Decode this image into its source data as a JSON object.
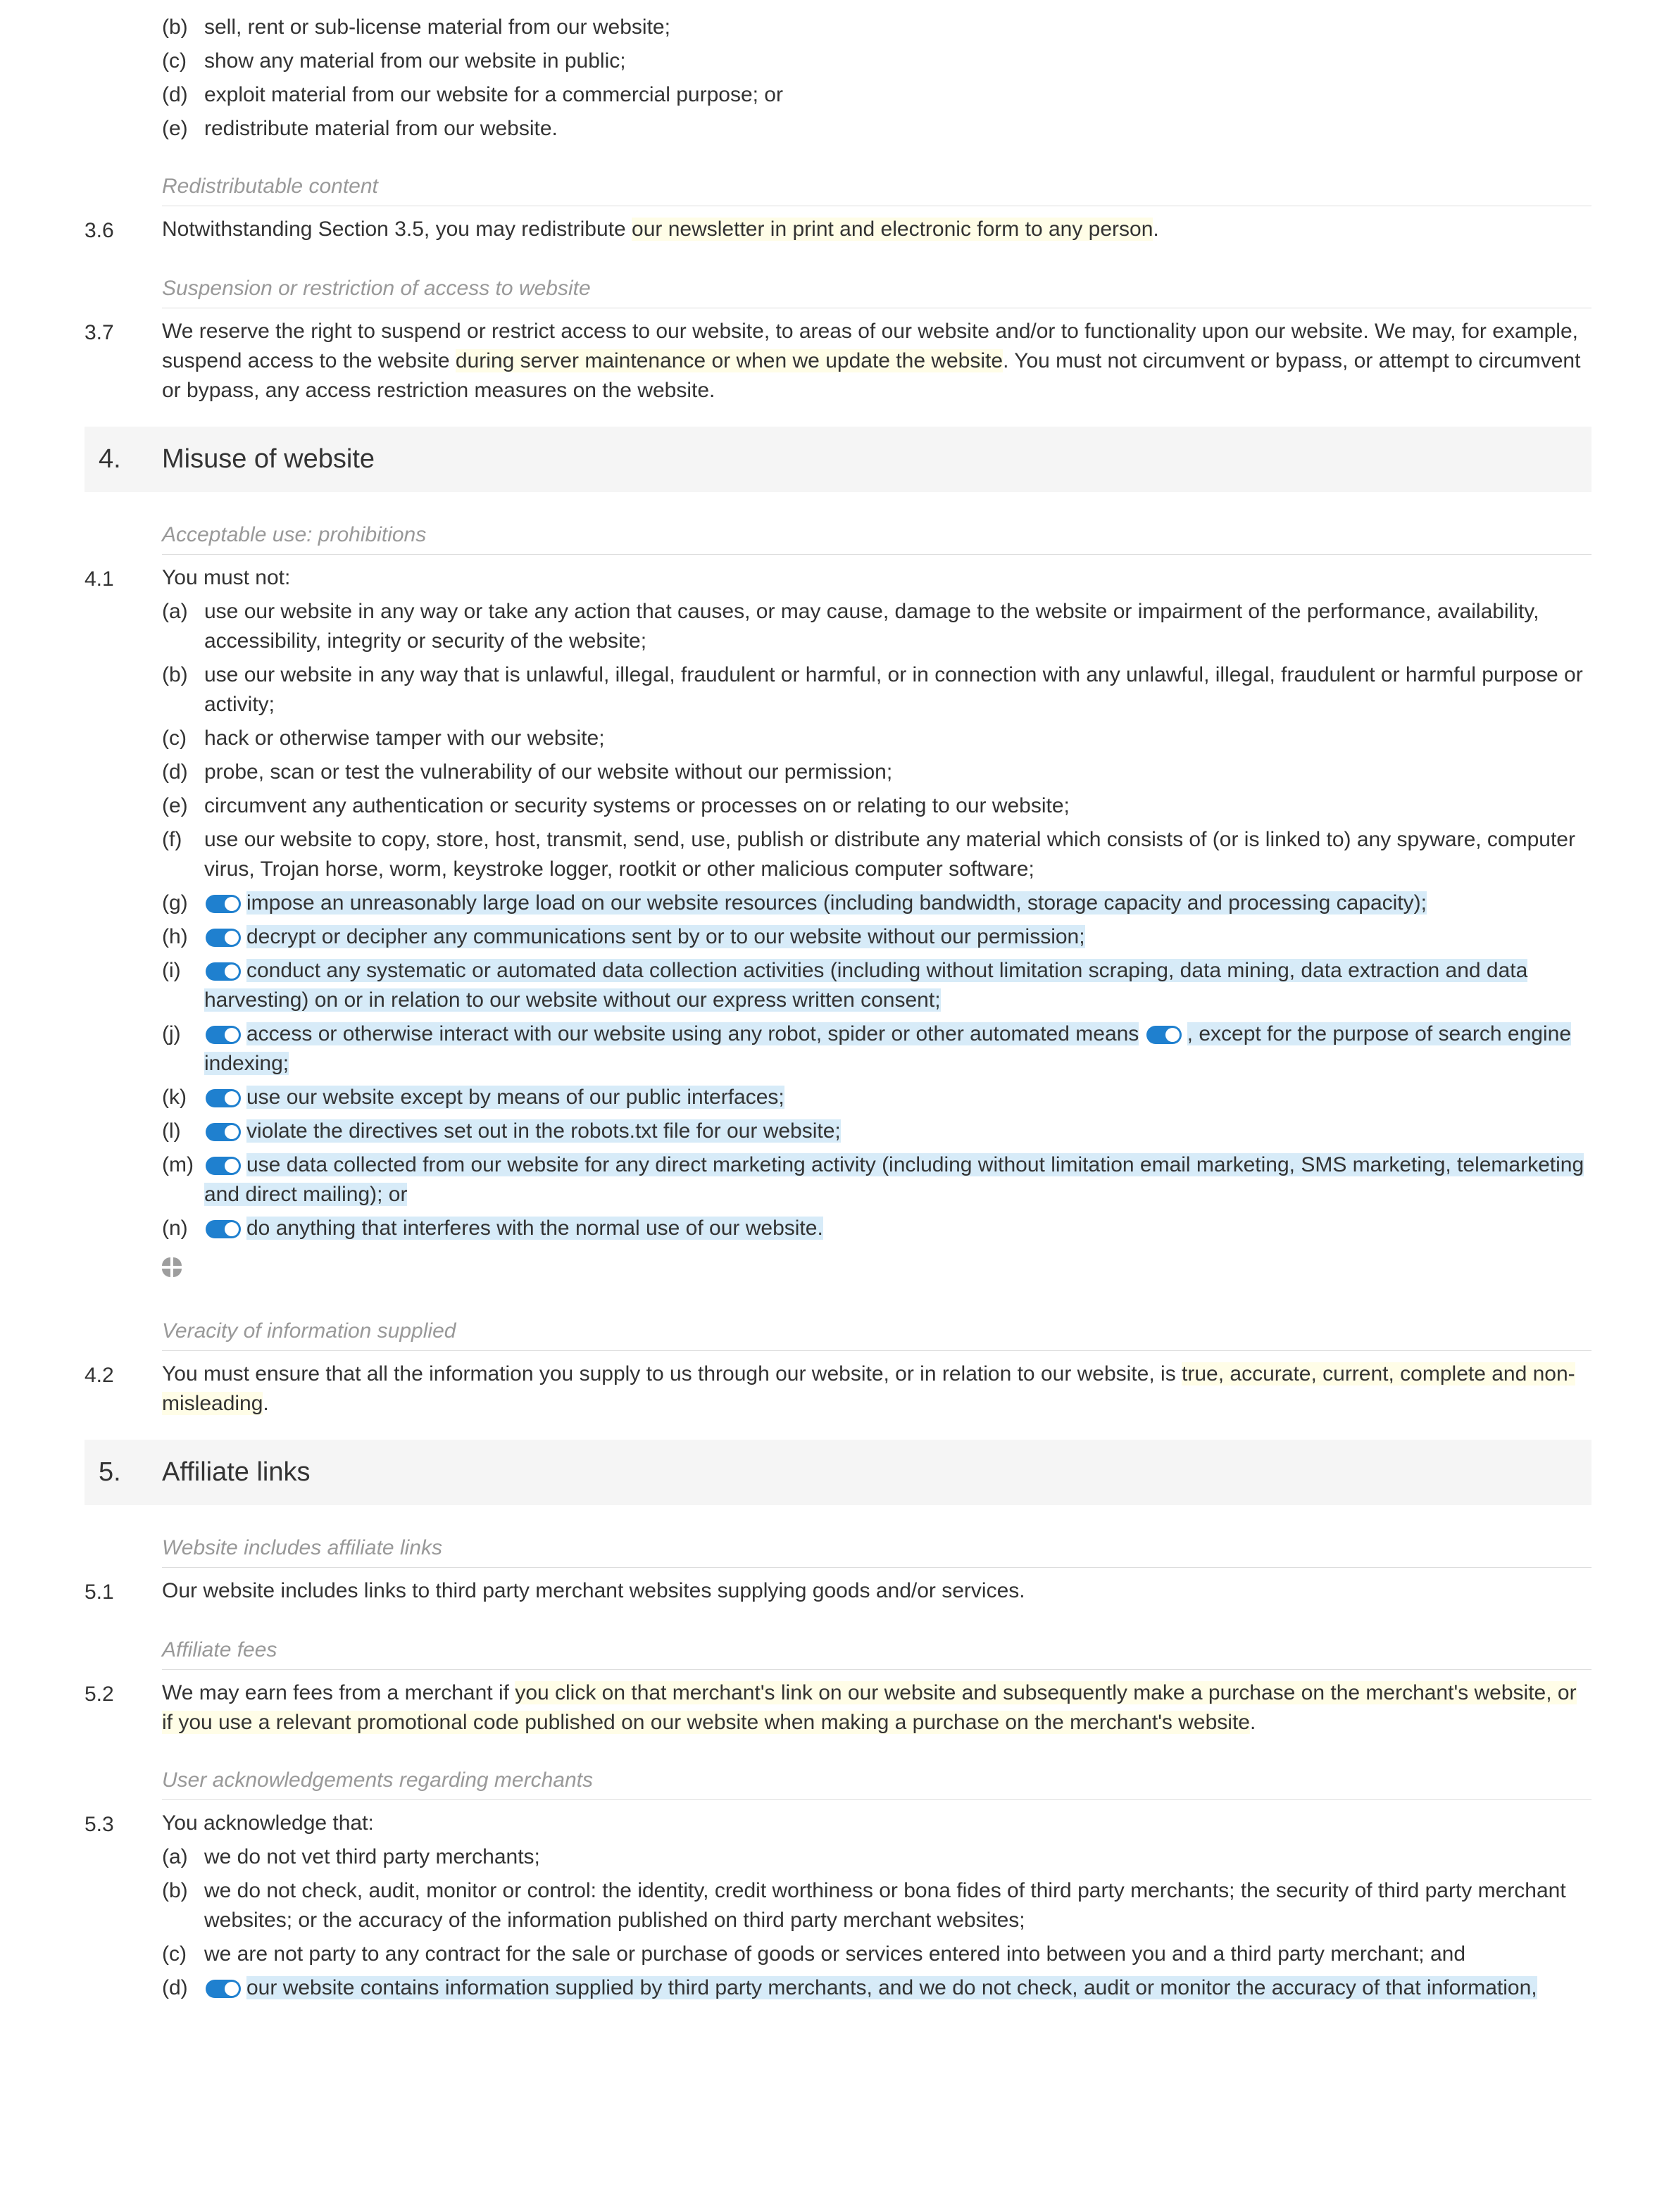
{
  "pre_items": {
    "b": "sell, rent or sub-license material from our website;",
    "c": "show any material from our website in public;",
    "d": "exploit material from our website for a commercial purpose; or",
    "e": "redistribute material from our website."
  },
  "sub_redist": "Redistributable content",
  "c36": {
    "num": "3.6",
    "pre": "Notwithstanding Section 3.5, you may redistribute ",
    "hl": "our newsletter in print and electronic form to any person",
    "post": "."
  },
  "sub_susp": "Suspension or restriction of access to website",
  "c37": {
    "num": "3.7",
    "t1": "We reserve the right to suspend or restrict access to our website, to areas of our website and/or to functionality upon our website. We may, for example, suspend access to the website ",
    "hl": "during server maintenance or when we update the website",
    "t2": ". You must not circumvent or bypass, or attempt to circumvent or bypass, any access restriction measures on the website."
  },
  "s4": {
    "num": "4.",
    "title": "Misuse of website"
  },
  "sub_acc": "Acceptable use: prohibitions",
  "c41": {
    "num": "4.1",
    "intro": "You must not:",
    "a": "use our website in any way or take any action that causes, or may cause, damage to the website or impairment of the performance, availability, accessibility, integrity or security of the website;",
    "b": "use our website in any way that is unlawful, illegal, fraudulent or harmful, or in connection with any unlawful, illegal, fraudulent or harmful purpose or activity;",
    "c": "hack or otherwise tamper with our website;",
    "d": "probe, scan or test the vulnerability of our website without our permission;",
    "e": "circumvent any authentication or security systems or processes on or relating to our website;",
    "f": "use our website to copy, store, host, transmit, send, use, publish or distribute any material which consists of (or is linked to) any spyware, computer virus, Trojan horse, worm, keystroke logger, rootkit or other malicious computer software;",
    "g": "impose an unreasonably large load on our website resources (including bandwidth, storage capacity and processing capacity);",
    "h": "decrypt or decipher any communications sent by or to our website without our permission;",
    "i": "conduct any systematic or automated data collection activities (including without limitation scraping, data mining, data extraction and data harvesting) on or in relation to our website without our express written consent;",
    "j1": "access or otherwise interact with our website using any robot, spider or other automated means",
    "j2": ", except for the purpose of search engine indexing;",
    "k": "use our website except by means of our public interfaces;",
    "l": "violate the directives set out in the robots.txt file for our website;",
    "m": "use data collected from our website for any direct marketing activity (including without limitation email marketing, SMS marketing, telemarketing and direct mailing); or",
    "n": "do anything that interferes with the normal use of our website."
  },
  "sub_ver": "Veracity of information supplied",
  "c42": {
    "num": "4.2",
    "t1": "You must ensure that all the information you supply to us through our website, or in relation to our website, is ",
    "hl": "true, accurate, current, complete and non-misleading",
    "t2": "."
  },
  "s5": {
    "num": "5.",
    "title": "Affiliate links"
  },
  "sub_aff1": "Website includes affiliate links",
  "c51": {
    "num": "5.1",
    "t": "Our website includes links to third party merchant websites supplying goods and/or services."
  },
  "sub_aff2": "Affiliate fees",
  "c52": {
    "num": "5.2",
    "t1": "We may earn fees from a merchant if ",
    "hl": "you click on that merchant's link on our website and subsequently make a purchase on the merchant's website, or if you use a relevant promotional code published on our website when making a purchase on the merchant's website",
    "t2": "."
  },
  "sub_aff3": "User acknowledgements regarding merchants",
  "c53": {
    "num": "5.3",
    "intro": "You acknowledge that:",
    "a": "we do not vet third party merchants;",
    "b": "we do not check, audit, monitor or control: the identity, credit worthiness or bona fides of third party merchants; the security of third party merchant websites; or the accuracy of the information published on third party merchant websites;",
    "c": "we are not party to any contract for the sale or purchase of goods or services entered into between you and a third party merchant; and",
    "d": "our website contains information supplied by third party merchants, and we do not check, audit or monitor the accuracy of that information,"
  }
}
